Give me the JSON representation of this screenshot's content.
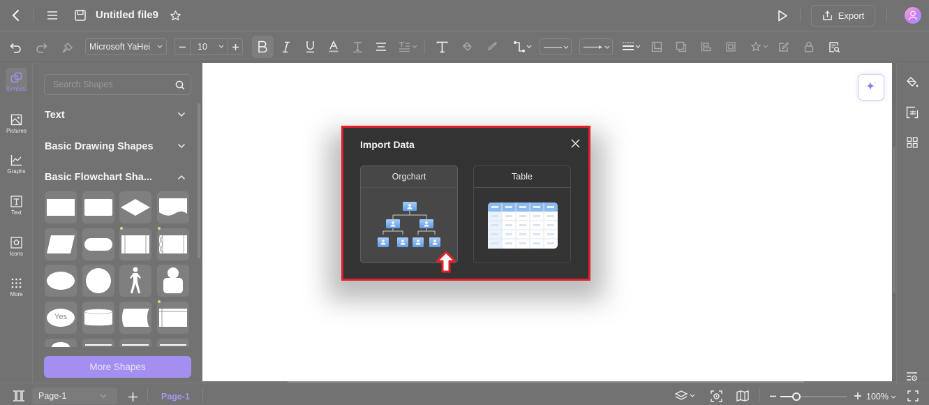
{
  "header": {
    "title": "Untitled file9",
    "export_label": "Export",
    "icons": [
      "back-chevron-icon",
      "menu-icon",
      "save-icon",
      "star-icon",
      "play-icon",
      "export-icon",
      "user-avatar"
    ]
  },
  "toolbar": {
    "font_family": "Microsoft YaHei",
    "font_size": "10",
    "buttons": [
      "undo",
      "redo",
      "format-painter",
      "decrease-font-size",
      "increase-font-size",
      "bold",
      "italic",
      "underline",
      "font-color",
      "text-style",
      "align",
      "line-spacing",
      "text-tool",
      "fill",
      "pen",
      "connector",
      "line-style",
      "arrow-style",
      "line-weight",
      "bring-front",
      "send-back",
      "align-shapes",
      "group",
      "effects",
      "edit",
      "lock",
      "find-replace"
    ]
  },
  "leftnav": {
    "items": [
      {
        "label": "Symbols",
        "icon": "symbols-icon",
        "active": true
      },
      {
        "label": "Pictures",
        "icon": "pictures-icon",
        "active": false
      },
      {
        "label": "Graphs",
        "icon": "graphs-icon",
        "active": false
      },
      {
        "label": "Text",
        "icon": "text-icon",
        "active": false
      },
      {
        "label": "Icons",
        "icon": "icons-icon",
        "active": false
      },
      {
        "label": "More",
        "icon": "more-grid-icon",
        "active": false
      }
    ]
  },
  "panel": {
    "search_placeholder": "Search Shapes",
    "sections": [
      {
        "title": "Text",
        "expanded": false
      },
      {
        "title": "Basic Drawing Shapes",
        "expanded": false
      },
      {
        "title": "Basic Flowchart Sha...",
        "expanded": true
      }
    ],
    "yes_label": "Yes",
    "more_shapes_label": "More Shapes"
  },
  "modal": {
    "title": "Import Data",
    "options": [
      {
        "label": "Orgchart",
        "selected": true
      },
      {
        "label": "Table",
        "selected": false
      }
    ],
    "highlight_color": "#e0202a"
  },
  "bottombar": {
    "page_select": "Page-1",
    "page_tab": "Page-1",
    "zoom": "100%",
    "zoom_fraction": 0.2
  },
  "colors": {
    "accent": "#a48ff0",
    "panel_bg": "#727272",
    "modal_bg": "#333333"
  }
}
